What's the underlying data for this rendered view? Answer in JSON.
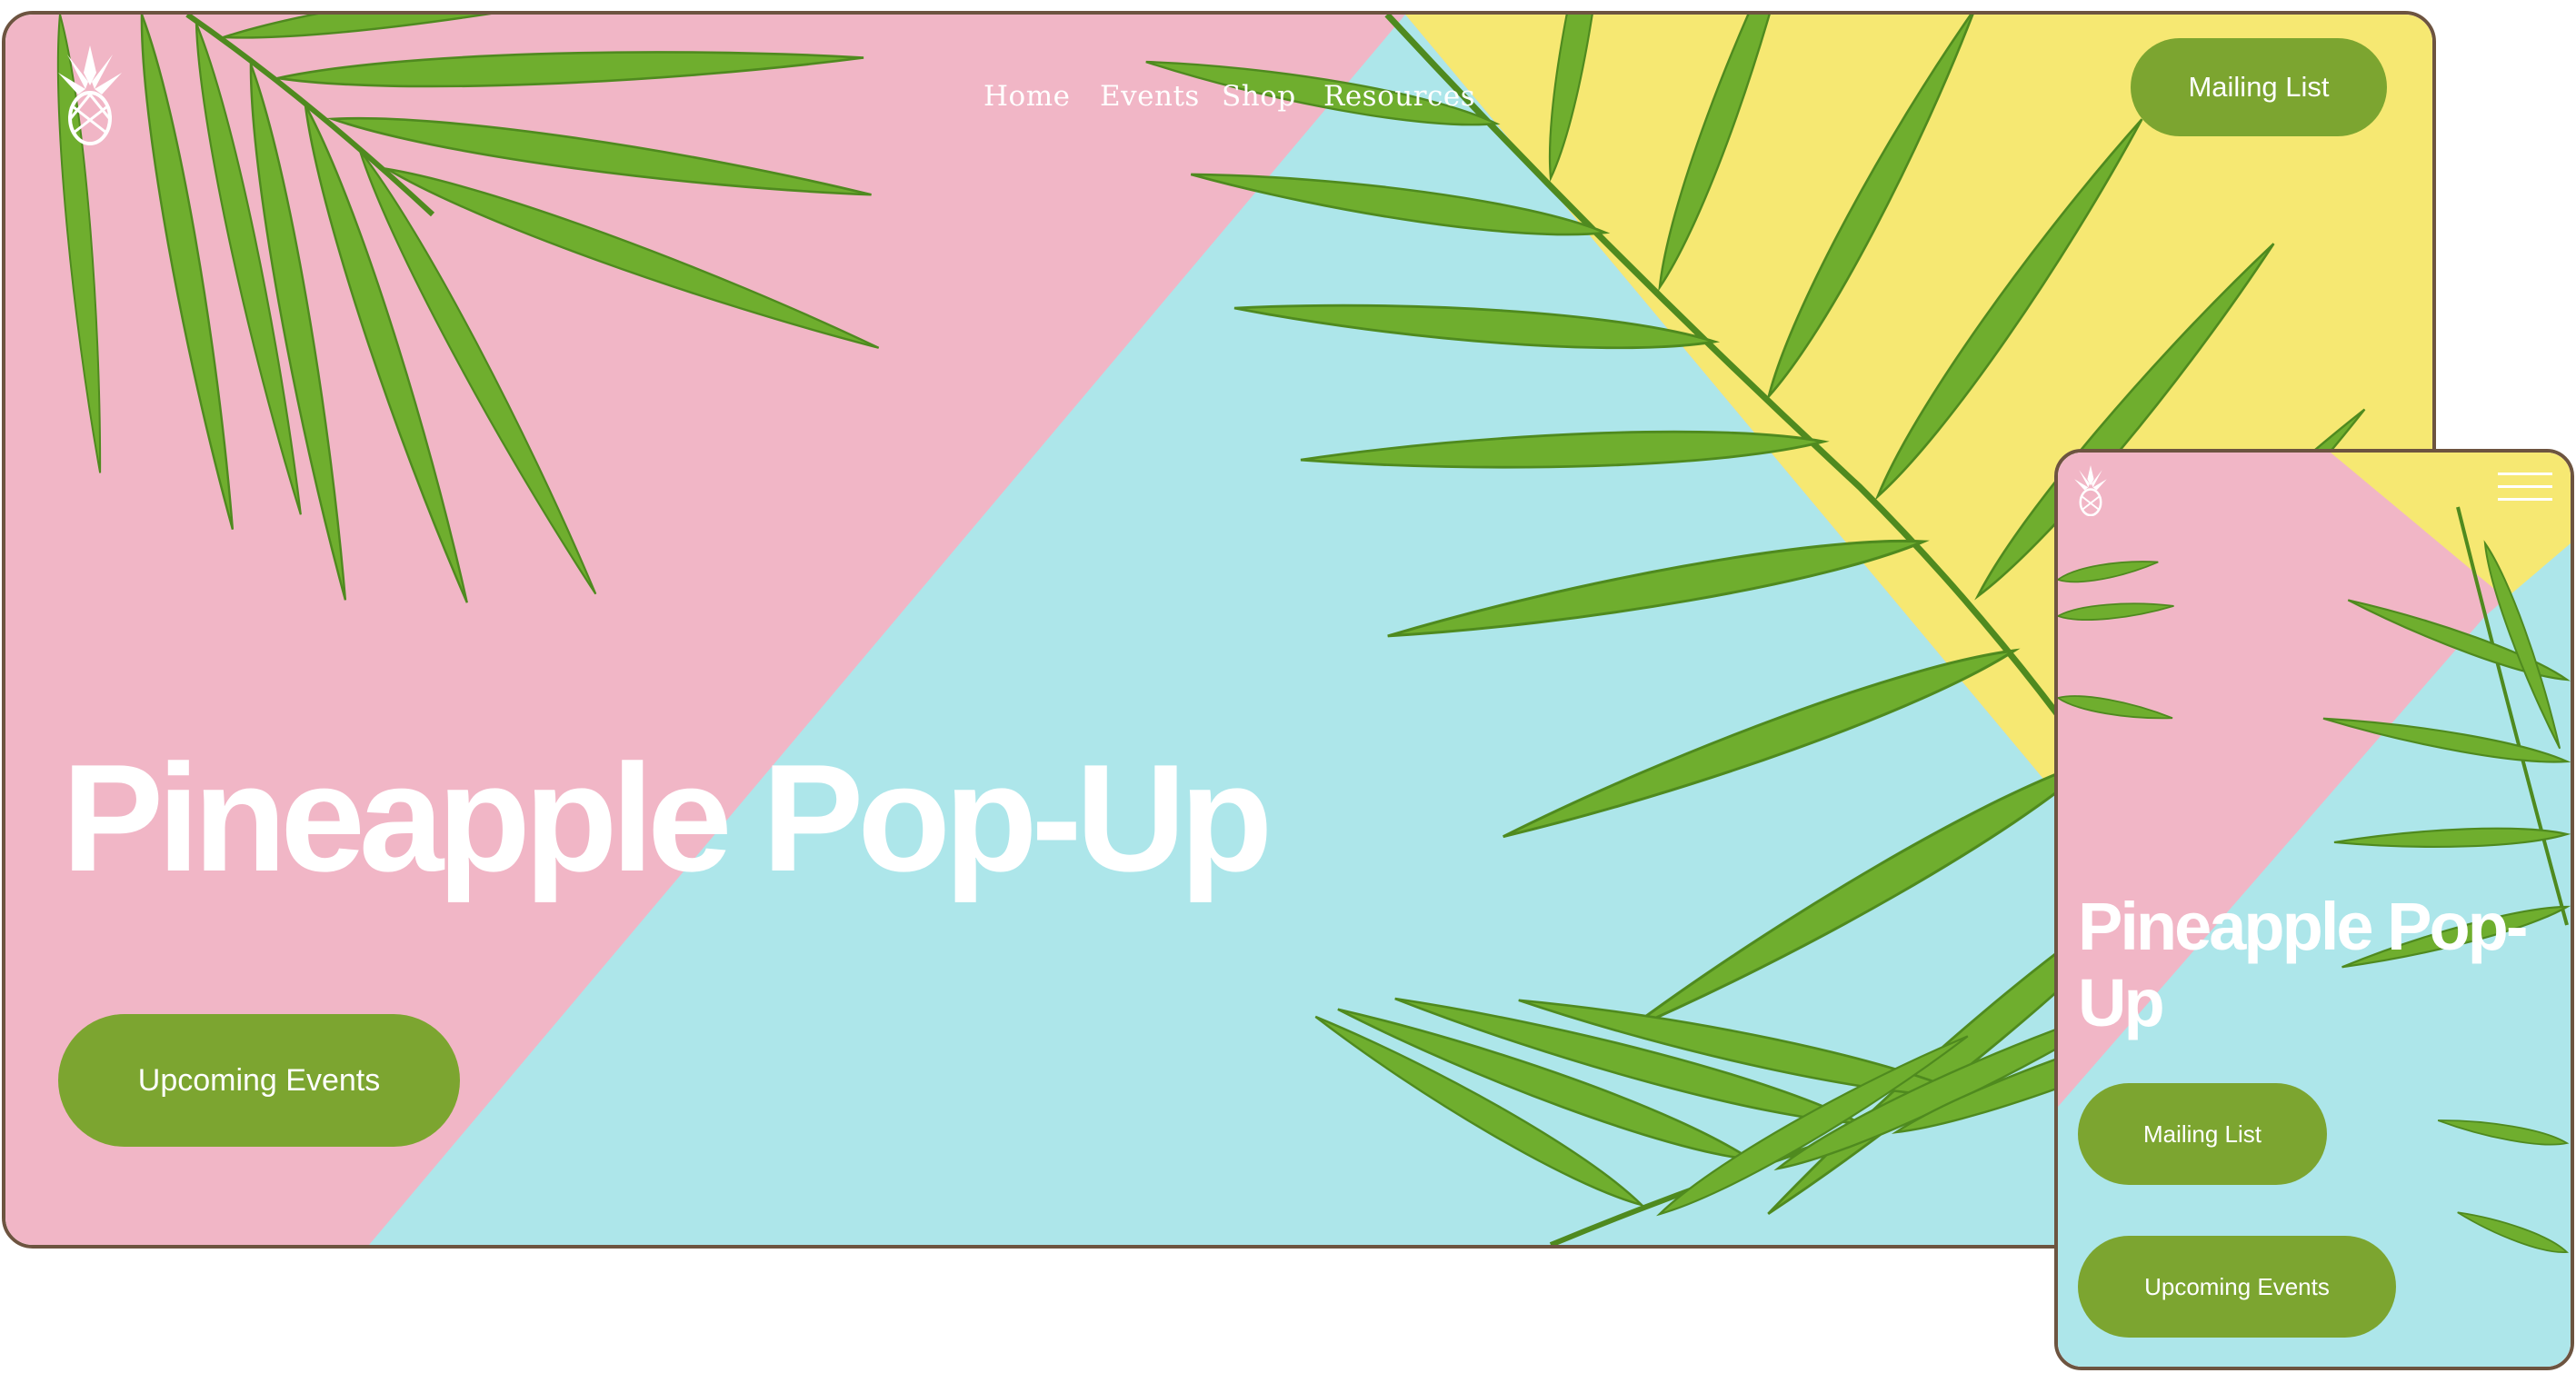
{
  "desktop": {
    "nav": {
      "items": [
        "Home",
        "Events",
        "Shop",
        "Resources"
      ],
      "mailing_label": "Mailing List"
    },
    "hero": {
      "title": "Pineapple Pop-Up",
      "cta_label": "Upcoming Events"
    }
  },
  "mobile": {
    "hero": {
      "title": "Pineapple Pop-Up",
      "mailing_label": "Mailing List",
      "cta_label": "Upcoming Events"
    }
  },
  "icons": {
    "logo": "pineapple-logo-icon",
    "menu": "hamburger-menu-icon"
  },
  "colors": {
    "accent": "#7ca530",
    "pink": "#f1b6c6",
    "yellow": "#f6e872",
    "aqua": "#ade6ea",
    "leaf": "#6fae2e",
    "frame": "#6d5440"
  }
}
